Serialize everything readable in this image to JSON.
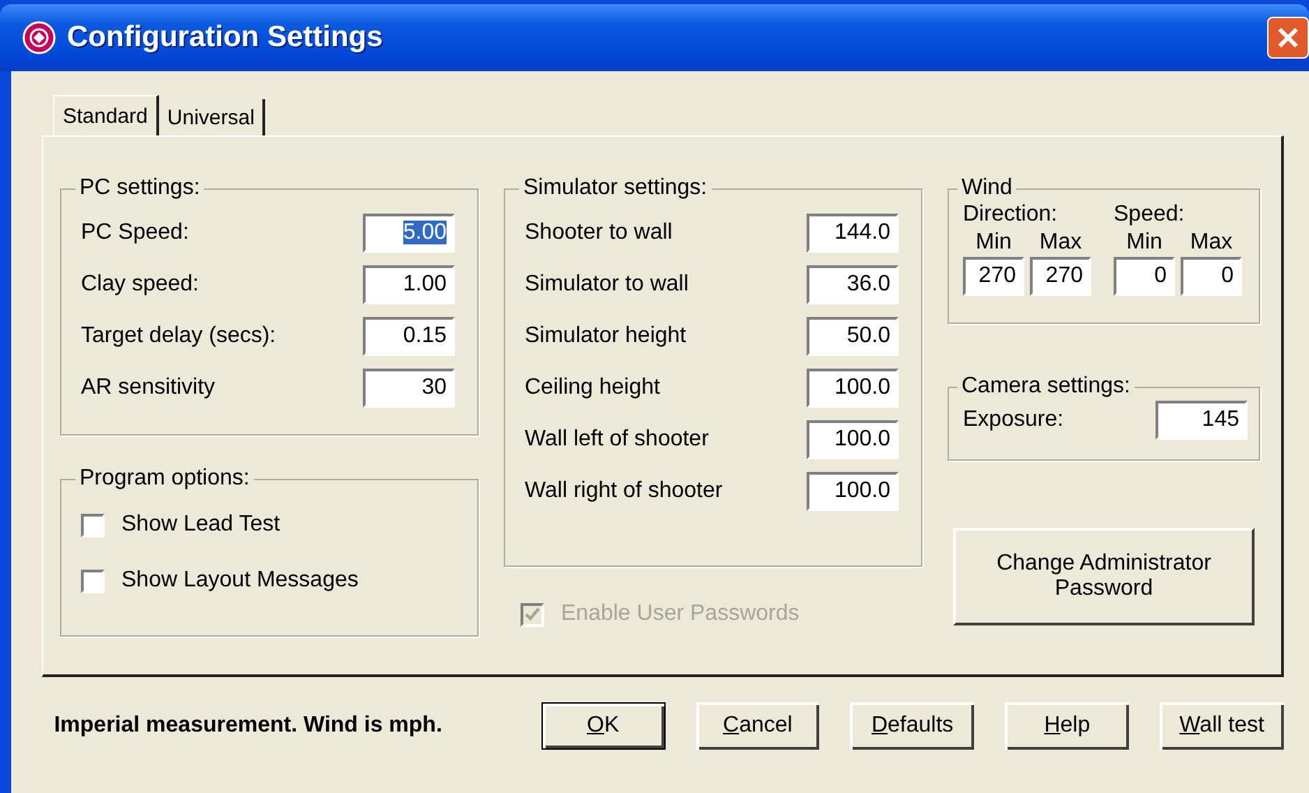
{
  "window": {
    "title": "Configuration Settings"
  },
  "tabs": [
    {
      "label": "Standard",
      "selected": true
    },
    {
      "label": "Universal",
      "selected": false
    }
  ],
  "pc_settings": {
    "title": "PC settings:",
    "fields": [
      {
        "label": "PC Speed:",
        "value": "5.00",
        "text_selected": true
      },
      {
        "label": "Clay speed:",
        "value": "1.00",
        "text_selected": false
      },
      {
        "label": "Target delay (secs):",
        "value": "0.15",
        "text_selected": false
      },
      {
        "label": "AR sensitivity",
        "value": "30",
        "text_selected": false
      }
    ]
  },
  "program_options": {
    "title": "Program options:",
    "options": [
      {
        "label": "Show Lead Test",
        "checked": false
      },
      {
        "label": "Show Layout Messages",
        "checked": false
      }
    ]
  },
  "simulator_settings": {
    "title": "Simulator settings:",
    "fields": [
      {
        "label": "Shooter to wall",
        "value": "144.0"
      },
      {
        "label": "Simulator to wall",
        "value": "36.0"
      },
      {
        "label": "Simulator height",
        "value": "50.0"
      },
      {
        "label": "Ceiling height",
        "value": "100.0"
      },
      {
        "label": "Wall left of shooter",
        "value": "100.0"
      },
      {
        "label": "Wall right of shooter",
        "value": "100.0"
      }
    ]
  },
  "enable_user_passwords": {
    "label": "Enable User Passwords",
    "checked": true,
    "disabled": true
  },
  "wind": {
    "title": "Wind",
    "groups": [
      {
        "label": "Direction:",
        "min_label": "Min",
        "max_label": "Max",
        "min": "270",
        "max": "270"
      },
      {
        "label": "Speed:",
        "min_label": "Min",
        "max_label": "Max",
        "min": "0",
        "max": "0"
      }
    ]
  },
  "camera_settings": {
    "title": "Camera settings:",
    "label": "Exposure:",
    "value": "145"
  },
  "change_password_button": "Change Administrator Password",
  "status_text": "Imperial measurement. Wind is mph.",
  "buttons": [
    {
      "mnemonic": "O",
      "rest": "K",
      "default": true
    },
    {
      "mnemonic": "C",
      "rest": "ancel",
      "default": false
    },
    {
      "mnemonic": "D",
      "rest": "efaults",
      "default": false
    },
    {
      "mnemonic": "H",
      "rest": "elp",
      "default": false
    },
    {
      "mnemonic": "W",
      "rest": "all test",
      "default": false
    }
  ]
}
